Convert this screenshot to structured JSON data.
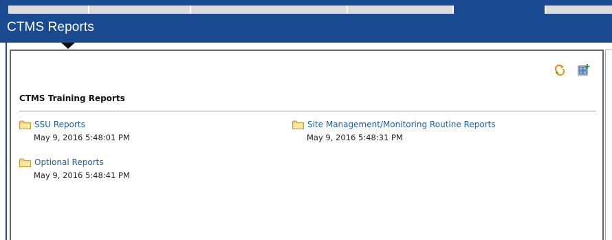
{
  "app": {
    "title": "CTMS Reports",
    "colors": {
      "header": "#1a4a90",
      "link": "#1c5fa3",
      "folder_fill": "#f7d06a",
      "folder_stroke": "#c79a2a",
      "icon_orange": "#e39a1c",
      "icon_green": "#3c9a3c"
    }
  },
  "toolbar": {
    "refresh_icon": "refresh-icon",
    "add_panel_icon": "add-panel-icon"
  },
  "section": {
    "title": "CTMS Training Reports"
  },
  "reports": [
    {
      "name": "SSU Reports",
      "date": "May 9, 2016 5:48:01 PM",
      "icon": "folder-icon"
    },
    {
      "name": "Site Management/Monitoring Routine Reports",
      "date": "May 9, 2016 5:48:31 PM",
      "icon": "folder-icon"
    },
    {
      "name": "Optional Reports",
      "date": "May 9, 2016 5:48:41 PM",
      "icon": "folder-icon"
    }
  ]
}
